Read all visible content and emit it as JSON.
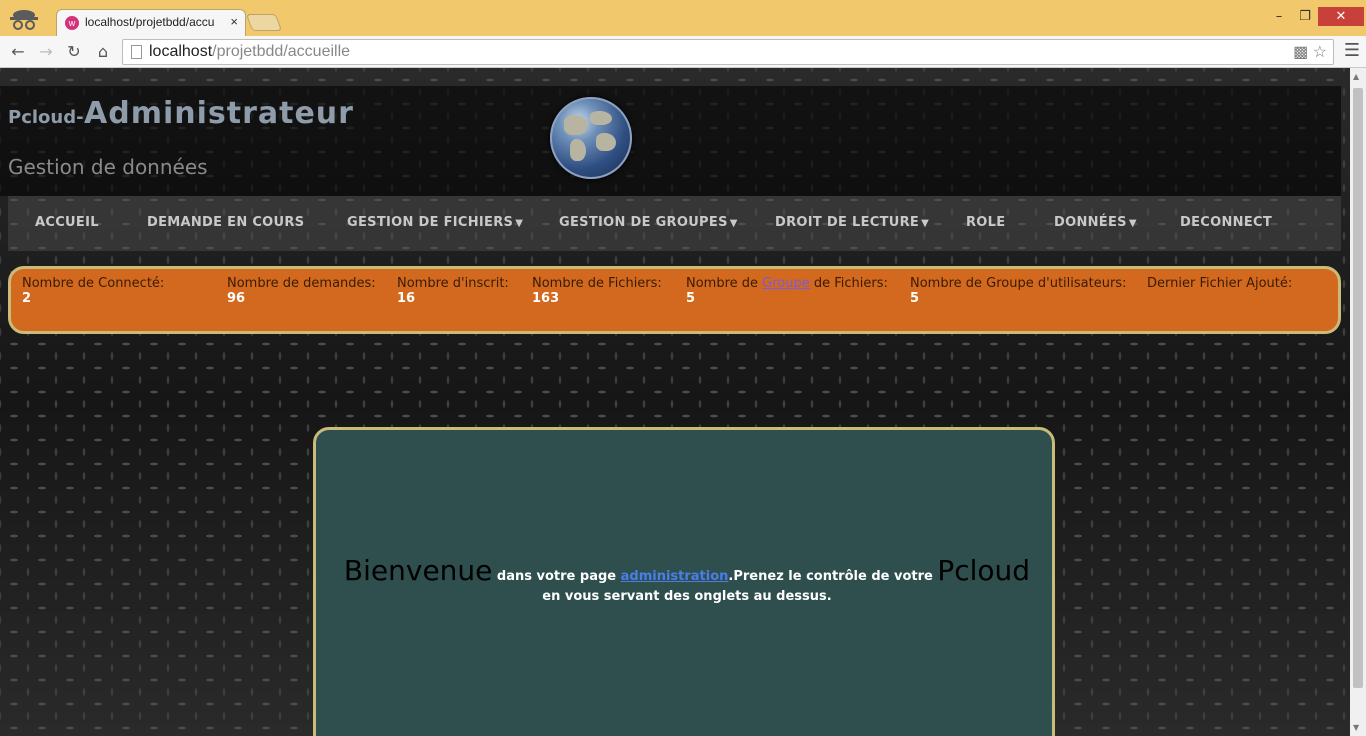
{
  "browser": {
    "tab_title": "localhost/projetbdd/accu",
    "tab_close": "×",
    "address_host": "localhost",
    "address_path": "/projetbdd/accueille",
    "window_minimize": "–",
    "window_restore": "❐",
    "window_close": "✕"
  },
  "site": {
    "title_prefix": "Pcloud-",
    "title_main": "Administrateur",
    "subtitle": "Gestion de données"
  },
  "nav": {
    "items": [
      {
        "label": "ACCUEIL",
        "dropdown": false
      },
      {
        "label": "DEMANDE EN COURS",
        "dropdown": false
      },
      {
        "label": "GESTION DE FICHIERS",
        "dropdown": true
      },
      {
        "label": "GESTION DE GROUPES",
        "dropdown": true
      },
      {
        "label": "DROIT DE LECTURE",
        "dropdown": true
      },
      {
        "label": "ROLE",
        "dropdown": false
      },
      {
        "label": "DONNÉES",
        "dropdown": true
      },
      {
        "label": "DECONNECT",
        "dropdown": false
      }
    ]
  },
  "stats": {
    "connected": {
      "label": "Nombre de Connecté:",
      "value": "2"
    },
    "requests": {
      "label": "Nombre de demandes:",
      "value": "96"
    },
    "registered": {
      "label": "Nombre d'inscrit:",
      "value": "16"
    },
    "files": {
      "label": "Nombre de Fichiers:",
      "value": "163"
    },
    "file_groups": {
      "label_before": "Nombre de ",
      "label_link": "Groupe",
      "label_after": " de Fichiers:",
      "value": "5"
    },
    "user_groups": {
      "label": "Nombre de Groupe d'utilisateurs:",
      "value": "5"
    },
    "last_file": {
      "label": "Dernier Fichier Ajouté:",
      "value": ""
    }
  },
  "welcome": {
    "big1": "Bienvenue",
    "text1": " dans votre page ",
    "link": "administration",
    "text2": ".Prenez le contrôle de votre ",
    "big2": "Pcloud",
    "text3": " en vous servant des onglets au dessus."
  },
  "colors": {
    "stats_bg": "#d2691e",
    "welcome_bg": "#2f4f4f",
    "border": "#c9bc78"
  },
  "icons": [
    "incognito-icon",
    "back-arrow-icon",
    "forward-arrow-icon",
    "reload-icon",
    "home-icon",
    "page-icon",
    "translate-icon",
    "star-icon",
    "menu-icon",
    "globe-icon",
    "caret-down-icon"
  ]
}
